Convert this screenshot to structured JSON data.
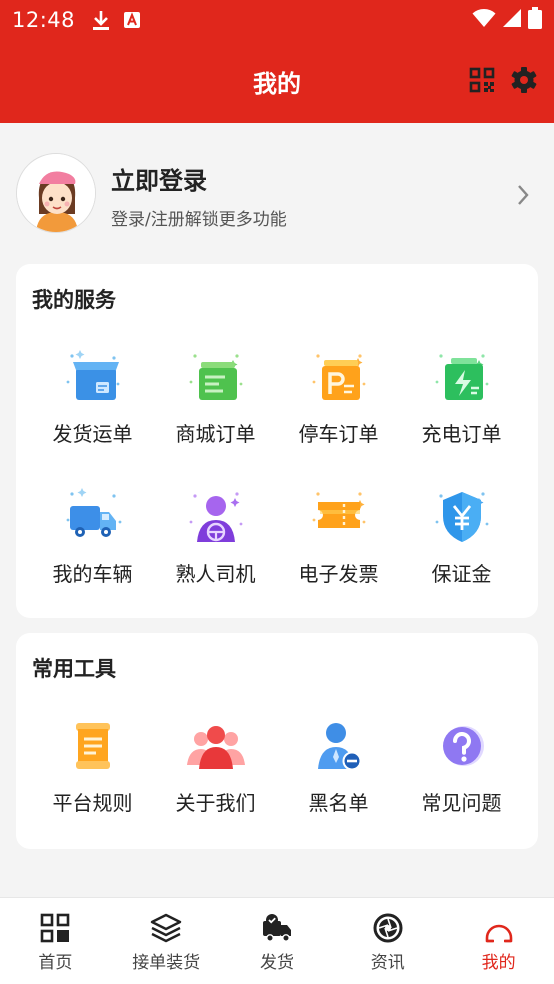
{
  "status_bar": {
    "time": "12:48",
    "icons": [
      "download-icon",
      "a-icon",
      "wifi-icon",
      "signal-icon",
      "battery-icon"
    ]
  },
  "header": {
    "title": "我的",
    "icons": [
      "qr-code-icon",
      "gear-icon"
    ]
  },
  "profile": {
    "title": "立即登录",
    "subtitle": "登录/注册解锁更多功能"
  },
  "services": {
    "title": "我的服务",
    "items": [
      {
        "label": "发货运单",
        "icon": "cargo-box-icon"
      },
      {
        "label": "商城订单",
        "icon": "mall-order-icon"
      },
      {
        "label": "停车订单",
        "icon": "parking-order-icon"
      },
      {
        "label": "充电订单",
        "icon": "charging-order-icon"
      },
      {
        "label": "我的车辆",
        "icon": "truck-icon"
      },
      {
        "label": "熟人司机",
        "icon": "driver-icon"
      },
      {
        "label": "电子发票",
        "icon": "invoice-ticket-icon"
      },
      {
        "label": "保证金",
        "icon": "deposit-shield-icon"
      }
    ]
  },
  "tools": {
    "title": "常用工具",
    "items": [
      {
        "label": "平台规则",
        "icon": "rules-scroll-icon"
      },
      {
        "label": "关于我们",
        "icon": "team-icon"
      },
      {
        "label": "黑名单",
        "icon": "blacklist-user-icon"
      },
      {
        "label": "常见问题",
        "icon": "question-icon"
      }
    ]
  },
  "bottom_nav": {
    "items": [
      {
        "label": "首页",
        "icon": "home-grid-icon"
      },
      {
        "label": "接单装货",
        "icon": "layers-icon"
      },
      {
        "label": "发货",
        "icon": "delivery-truck-icon"
      },
      {
        "label": "资讯",
        "icon": "aperture-icon"
      },
      {
        "label": "我的",
        "icon": "profile-icon",
        "active": true
      }
    ]
  },
  "colors": {
    "brand_red": "#e0271c",
    "background": "#f4f4f4",
    "card": "#ffffff"
  }
}
